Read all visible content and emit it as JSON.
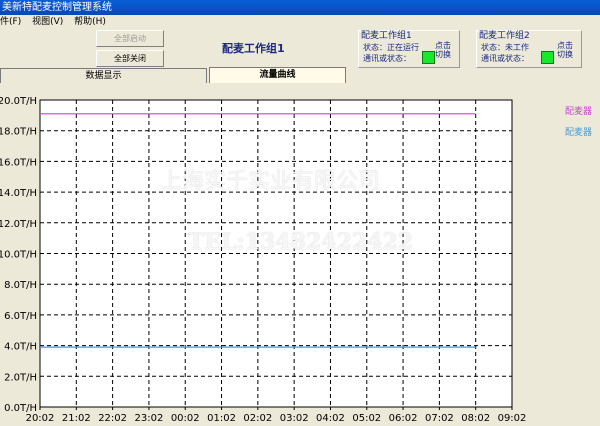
{
  "window": {
    "title": "美新特配麦控制管理系统"
  },
  "menu": {
    "items": [
      "件(F)",
      "视图(V)",
      "帮助(H)"
    ]
  },
  "toolbar": {
    "start_all": "全部启动",
    "stop_all": "全部关闭"
  },
  "group_title": "配麦工作组1",
  "workgroups": [
    {
      "title": "配麦工作组1",
      "status": "状态：正在运行",
      "comm": "通讯或状态：",
      "switch_top": "点击",
      "switch_bottom": "切换"
    },
    {
      "title": "配麦工作组2",
      "status": "状态：未工作",
      "comm": "通讯或状态：",
      "switch_top": "点击",
      "switch_bottom": "切换"
    }
  ],
  "tabs": [
    "数据显示",
    "流量曲线"
  ],
  "active_tab": "流量曲线",
  "watermark": {
    "company": "上海实千实业有限公司",
    "tel": "TEL:13482422422"
  },
  "legend": [
    {
      "label": "配麦器",
      "color": "#cc44cc"
    },
    {
      "label": "配麦器",
      "color": "#4a9ad0"
    }
  ],
  "chart_data": {
    "type": "line",
    "title": "",
    "xlabel": "",
    "ylabel": "",
    "ylim": [
      0,
      20
    ],
    "y_ticks": [
      "0.0T/H",
      "2.0T/H",
      "4.0T/H",
      "6.0T/H",
      "8.0T/H",
      "10.0T/H",
      "12.0T/H",
      "14.0T/H",
      "16.0T/H",
      "18.0T/H",
      "20.0T/H"
    ],
    "x_ticks": [
      "20:02",
      "21:02",
      "22:02",
      "23:02",
      "00:02",
      "01:02",
      "02:02",
      "03:02",
      "04:02",
      "05:02",
      "06:02",
      "07:02",
      "08:02",
      "09:02"
    ],
    "grid": true,
    "series": [
      {
        "name": "配麦器",
        "color": "#cc44cc",
        "x": [
          "20:02",
          "08:02"
        ],
        "values": [
          19.1,
          19.1
        ]
      },
      {
        "name": "配麦器",
        "color": "#4a9ad0",
        "x": [
          "20:02",
          "08:02"
        ],
        "values": [
          3.9,
          3.9
        ]
      }
    ]
  }
}
